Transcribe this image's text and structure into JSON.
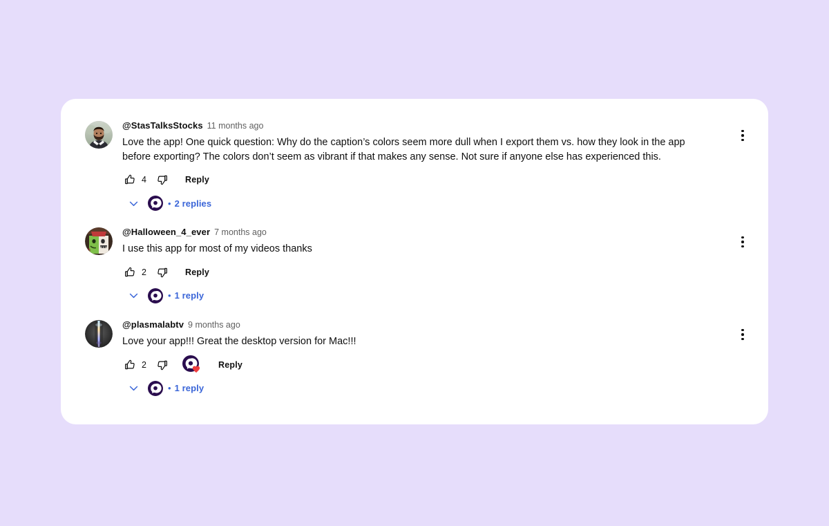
{
  "theme": {
    "page_background": "#e6ddfb",
    "card_background": "#ffffff",
    "text_primary": "#0f0f0f",
    "text_secondary": "#606060",
    "link_blue": "#3b66d8",
    "channel_purple": "#2a0d4e",
    "heart_red": "#ef3d3d"
  },
  "comments": [
    {
      "author": "@StasTalksStocks",
      "timestamp": "11 months ago",
      "text": "Love the app! One quick question: Why do the caption’s colors seem more dull when I export them vs. how they look in the app before exporting? The colors don’t seem as vibrant if that makes any sense. Not sure if anyone else has experienced this.",
      "like_count": "4",
      "reply_label": "Reply",
      "hearted_by_creator": false,
      "replies_label": "2 replies",
      "dot": "•",
      "avatar": "avatar-stastalksstocks",
      "menu_icon": "kebab-menu-icon",
      "like_icon": "thumbs-up-icon",
      "dislike_icon": "thumbs-down-icon",
      "chevron_icon": "chevron-down-icon",
      "channel_avatar_icon": "channel-avatar-icon"
    },
    {
      "author": "@Halloween_4_ever",
      "timestamp": "7 months ago",
      "text": "I use this app for most of my videos thanks",
      "like_count": "2",
      "reply_label": "Reply",
      "hearted_by_creator": false,
      "replies_label": "1 reply",
      "dot": "•",
      "avatar": "avatar-halloween4ever",
      "menu_icon": "kebab-menu-icon",
      "like_icon": "thumbs-up-icon",
      "dislike_icon": "thumbs-down-icon",
      "chevron_icon": "chevron-down-icon",
      "channel_avatar_icon": "channel-avatar-icon"
    },
    {
      "author": "@plasmalabtv",
      "timestamp": "9 months ago",
      "text": "Love your app!!! Great the desktop version for Mac!!!",
      "like_count": "2",
      "reply_label": "Reply",
      "hearted_by_creator": true,
      "replies_label": "1 reply",
      "dot": "•",
      "avatar": "avatar-plasmalabtv",
      "menu_icon": "kebab-menu-icon",
      "like_icon": "thumbs-up-icon",
      "dislike_icon": "thumbs-down-icon",
      "heart_icon": "creator-heart-icon",
      "chevron_icon": "chevron-down-icon",
      "channel_avatar_icon": "channel-avatar-icon"
    }
  ]
}
